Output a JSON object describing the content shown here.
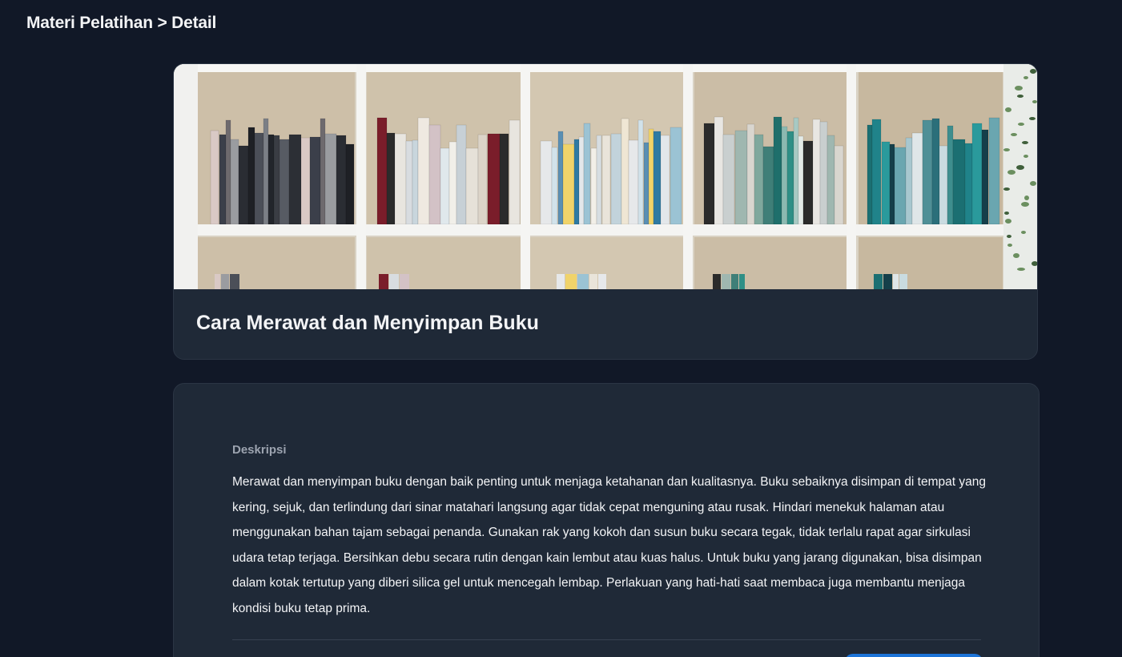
{
  "header": {
    "breadcrumb": "Materi Pelatihan > Detail"
  },
  "material": {
    "title": "Cara Merawat dan Menyimpan Buku",
    "image_alt": "bookshelf-photo"
  },
  "description": {
    "label": "Deskripsi",
    "text": "Merawat dan menyimpan buku dengan baik penting untuk menjaga ketahanan dan kualitasnya. Buku sebaiknya disimpan di tempat yang kering, sejuk, dan terlindung dari sinar matahari langsung agar tidak cepat menguning atau rusak. Hindari menekuk halaman atau menggunakan bahan tajam sebagai penanda. Gunakan rak yang kokoh dan susun buku secara tegak, tidak terlalu rapat agar sirkulasi udara tetap terjaga. Bersihkan debu secara rutin dengan kain lembut atau kuas halus. Untuk buku yang jarang digunakan, bisa disimpan dalam kotak tertutup yang diberi silica gel untuk mencegah lembap. Perlakuan yang hati-hati saat membaca juga membantu menjaga kondisi buku tetap prima."
  },
  "colors": {
    "background": "#111827",
    "card": "#1f2937",
    "accent": "#1d74d8"
  }
}
